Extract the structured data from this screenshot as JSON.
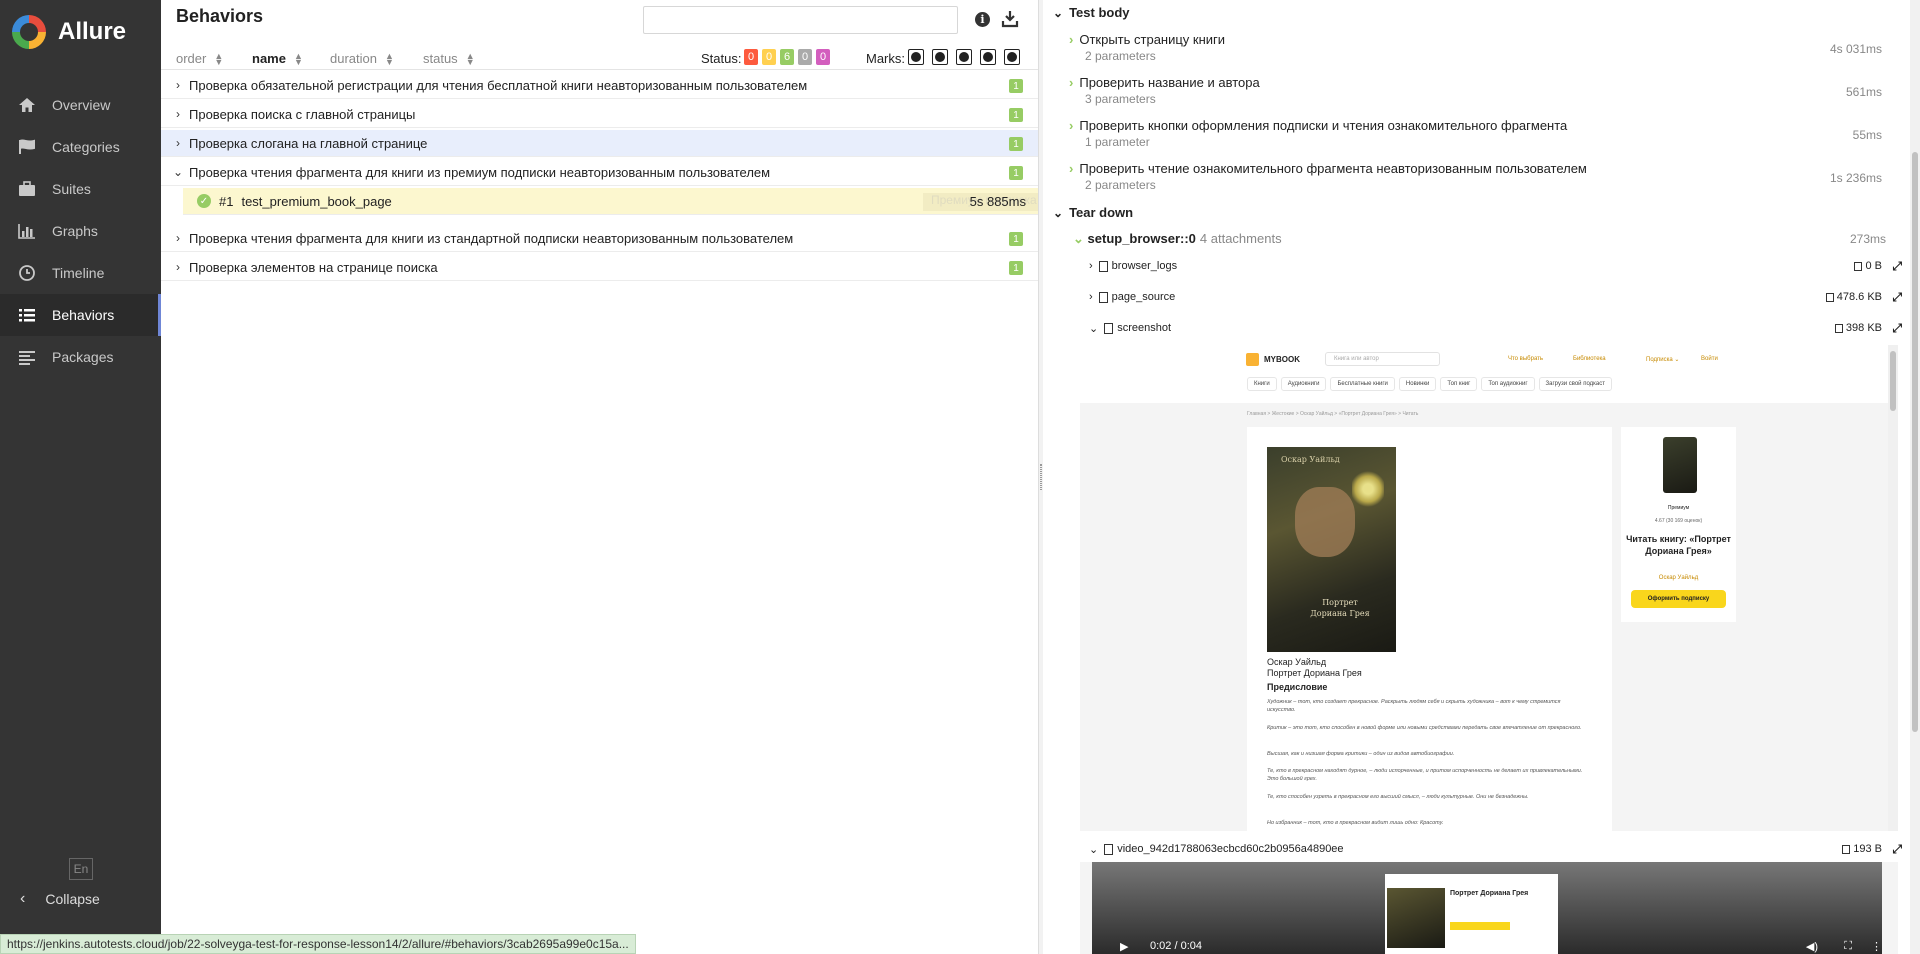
{
  "app": {
    "name": "Allure"
  },
  "sidebar": {
    "items": [
      {
        "label": "Overview",
        "icon": "home-icon"
      },
      {
        "label": "Categories",
        "icon": "flag-icon"
      },
      {
        "label": "Suites",
        "icon": "briefcase-icon"
      },
      {
        "label": "Graphs",
        "icon": "bar-chart-icon"
      },
      {
        "label": "Timeline",
        "icon": "clock-icon"
      },
      {
        "label": "Behaviors",
        "icon": "list-icon",
        "active": true
      },
      {
        "label": "Packages",
        "icon": "align-left-icon"
      }
    ],
    "language": "En",
    "collapse_label": "Collapse"
  },
  "behaviors": {
    "title": "Behaviors",
    "search_value": "",
    "sort": {
      "order": "order",
      "name": "name",
      "duration": "duration",
      "status": "status"
    },
    "status_label": "Status:",
    "status_counts": [
      {
        "value": "0",
        "color": "#fd5a3e"
      },
      {
        "value": "0",
        "color": "#ffd050"
      },
      {
        "value": "6",
        "color": "#97cc64"
      },
      {
        "value": "0",
        "color": "#aaaaaa"
      },
      {
        "value": "0",
        "color": "#d35ebe"
      }
    ],
    "marks_label": "Marks:",
    "groups": [
      {
        "name": "Проверка обязательной регистрации для чтения бесплатной книги неавторизованным пользователем",
        "count": "1",
        "expanded": false
      },
      {
        "name": "Проверка поиска с главной страницы",
        "count": "1",
        "expanded": false
      },
      {
        "name": "Проверка слогана на главной странице",
        "count": "1",
        "expanded": false
      },
      {
        "name": "Проверка чтения фрагмента для книги из премиум подписки неавторизованным пользователем",
        "count": "1",
        "expanded": true
      },
      {
        "name": "Проверка чтения фрагмента для книги из стандартной подписки неавторизованным пользователем",
        "count": "1",
        "expanded": false
      },
      {
        "name": "Проверка элементов на странице поиска",
        "count": "1",
        "expanded": false
      }
    ],
    "selected_test": {
      "number": "#1",
      "name": "test_premium_book_page",
      "duration": "5s 885ms",
      "ghost_label": "Премиум подписка"
    }
  },
  "status_bar_url": "https://jenkins.autotests.cloud/job/22-solveyga-test-for-response-lesson14/2/allure/#behaviors/3cab2695a99e0c15a...",
  "details": {
    "test_body_label": "Test body",
    "steps": [
      {
        "name": "Открыть страницу книги",
        "params": "2 parameters",
        "duration": "4s 031ms"
      },
      {
        "name": "Проверить название и автора",
        "params": "3 parameters",
        "duration": "561ms"
      },
      {
        "name": "Проверить кнопки оформления подписки и чтения ознакомительного фрагмента",
        "params": "1 parameter",
        "duration": "55ms"
      },
      {
        "name": "Проверить чтение ознакомительного фрагмента неавторизованным пользователем",
        "params": "2 parameters",
        "duration": "1s 236ms"
      }
    ],
    "tear_down_label": "Tear down",
    "fixture": {
      "name": "setup_browser::0",
      "attachments": "4 attachments",
      "duration": "273ms"
    },
    "attachments": [
      {
        "name": "browser_logs",
        "size": "0 B",
        "expanded": false
      },
      {
        "name": "page_source",
        "size": "478.6 KB",
        "expanded": false
      },
      {
        "name": "screenshot",
        "size": "398 KB",
        "expanded": true
      },
      {
        "name": "video_942d1788063ecbcd60c2b0956a4890ee",
        "size": "193 B",
        "expanded": true
      }
    ],
    "video_time": "0:02 / 0:04"
  },
  "screenshot_page": {
    "logo": "MYBOOK",
    "search_placeholder": "Книга или автор",
    "nav": [
      "Что выбрать",
      "Библиотека",
      "Подписка ⌄",
      "Войти"
    ],
    "tabs": [
      "Книги",
      "Аудиокниги",
      "Бесплатные книги",
      "Новинки",
      "Топ книг",
      "Топ аудиокниг",
      "Загрузи свой подкаст"
    ],
    "breadcrumbs": "Главная  >  Жестокие  >  Оскар Уайльд  >  «Портрет Дориана Грея»  >  Читать",
    "cover_author": "Оскар Уайльд",
    "cover_title": "Портрет Дориана Грея",
    "book_author": "Оскар Уайльд",
    "book_title": "Портрет Дориана Грея",
    "preface": "Предисловие",
    "paragraphs": [
      "Художник – тот, кто создает прекрасное. Раскрыть людям себя и скрыть художника – вот к чему стремится искусство.",
      "Критик – это тот, кто способен в новой форме или новыми средствами передать свое впечатление от прекрасного.",
      "Высшая, как и низшая форма критики – один из видов автобиографии.",
      "Те, кто в прекрасном находят дурное, – люди испорченные, и притом испорченность не делает их привлекательными. Это большой грех.",
      "Те, кто способен узреть в прекрасном его высший смысл, – люди культурные. Они не безнадежны.",
      "Но избранник – тот, кто в прекрасном видит лишь одно: Красоту."
    ],
    "side_premium": "Премиум",
    "side_rating": "4.67 (30 169 оценок)",
    "side_read": "Читать книгу: «Портрет Дориана Грея»",
    "side_author": "Оскар Уайльд",
    "side_button": "Оформить подписку"
  }
}
